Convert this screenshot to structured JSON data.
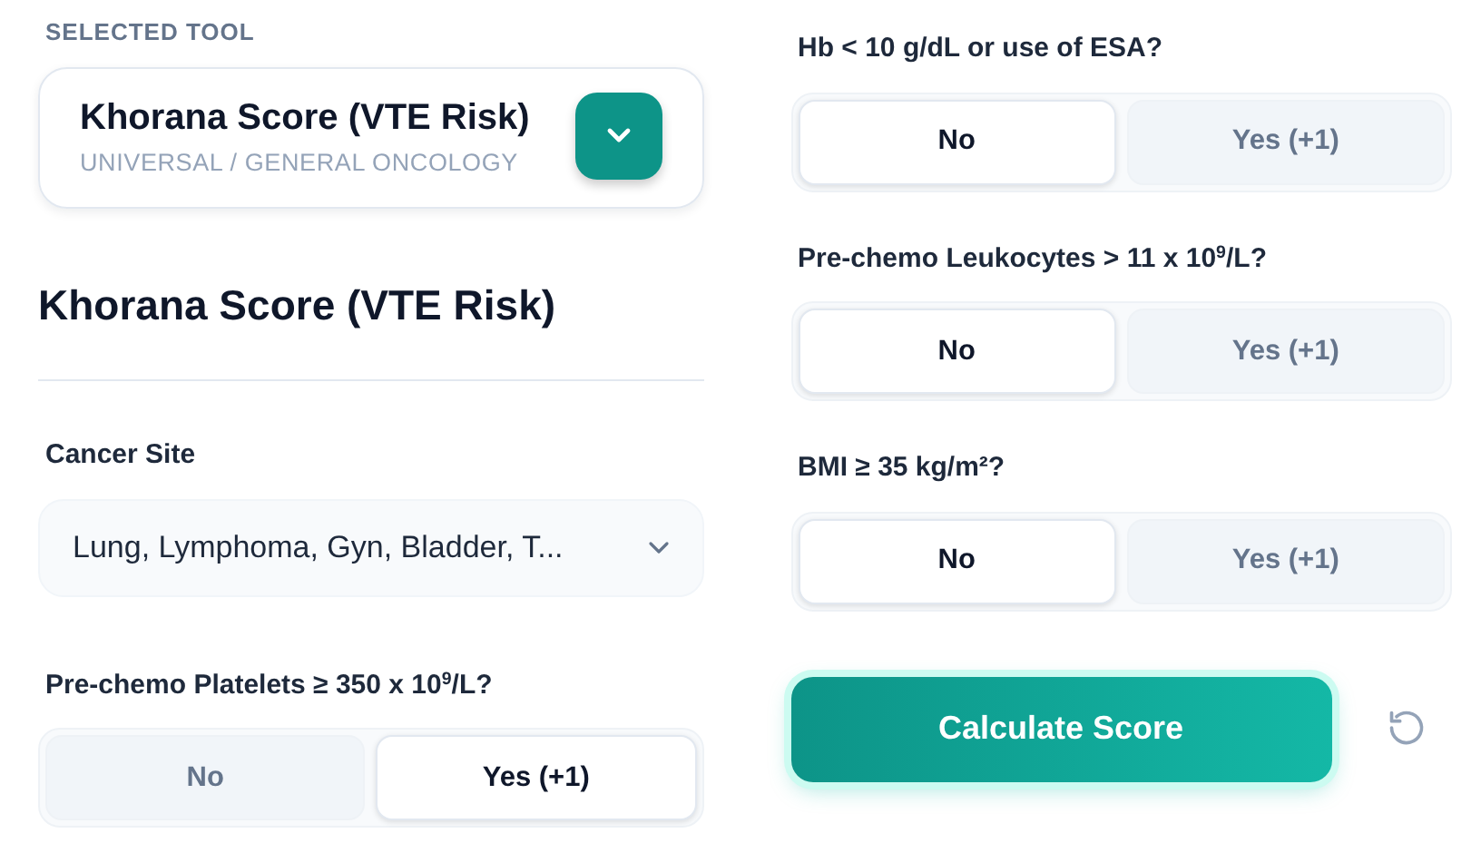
{
  "tool_picker": {
    "label": "SELECTED TOOL",
    "name": "Khorana Score (VTE Risk)",
    "category": "UNIVERSAL / GENERAL ONCOLOGY"
  },
  "heading": "Khorana Score (VTE Risk)",
  "cancer_site": {
    "label": "Cancer Site",
    "value": "Lung, Lymphoma, Gyn, Bladder, T..."
  },
  "questions": [
    {
      "text": "Pre-chemo Platelets ≥ 350 x 10$^{9}$/L?",
      "options": [
        {
          "label": "No",
          "selected": false
        },
        {
          "label": "Yes (+1)",
          "selected": true
        }
      ]
    },
    {
      "text": "Hb < 10 g/dL or use of ESA?",
      "options": [
        {
          "label": "No",
          "selected": true
        },
        {
          "label": "Yes (+1)",
          "selected": false
        }
      ]
    },
    {
      "text": "Pre-chemo Leukocytes > 11 x 10$^{9}$/L?",
      "options": [
        {
          "label": "No",
          "selected": true
        },
        {
          "label": "Yes (+1)",
          "selected": false
        }
      ]
    },
    {
      "text": "BMI ≥ 35 kg/m²?",
      "options": [
        {
          "label": "No",
          "selected": true
        },
        {
          "label": "Yes (+1)",
          "selected": false
        }
      ]
    }
  ],
  "calculate_button": "Calculate Score"
}
